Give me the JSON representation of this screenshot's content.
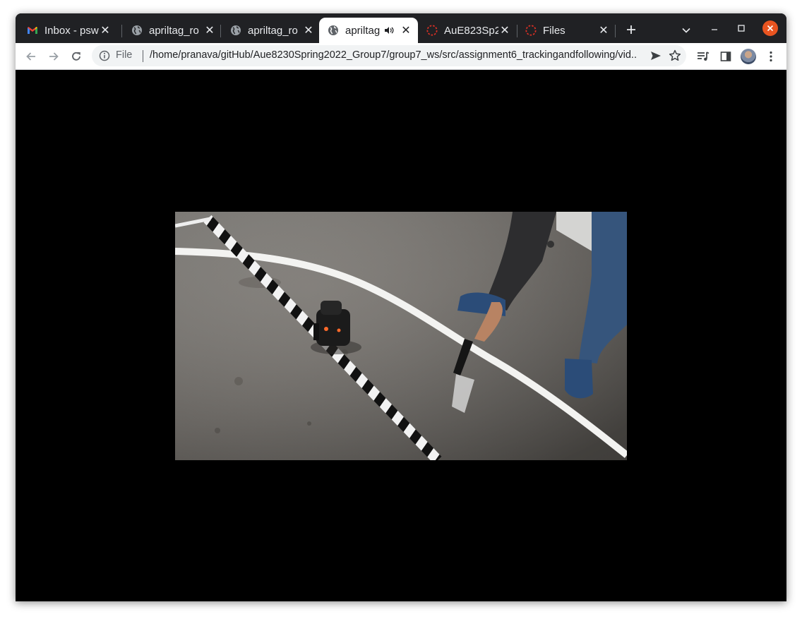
{
  "window": {
    "tabs": [
      {
        "title": "Inbox - psw",
        "favicon": "gmail-icon"
      },
      {
        "title": "apriltag_ro",
        "favicon": "globe-icon"
      },
      {
        "title": "apriltag_ro",
        "favicon": "globe-icon"
      },
      {
        "title": "apriltag",
        "favicon": "globe-icon",
        "active": true,
        "audio": true
      },
      {
        "title": "AuE823Sp2",
        "favicon": "loading-icon"
      },
      {
        "title": "Files",
        "favicon": "loading-icon"
      }
    ]
  },
  "omnibox": {
    "scheme_label": "File",
    "url": "/home/pranava/gitHub/Aue8230Spring2022_Group7/group7_ws/src/assignment6_trackingandfollowing/vid..."
  },
  "colors": {
    "tab_strip": "#202124",
    "close_button": "#e95420",
    "loading_icon": "#d93025"
  }
}
